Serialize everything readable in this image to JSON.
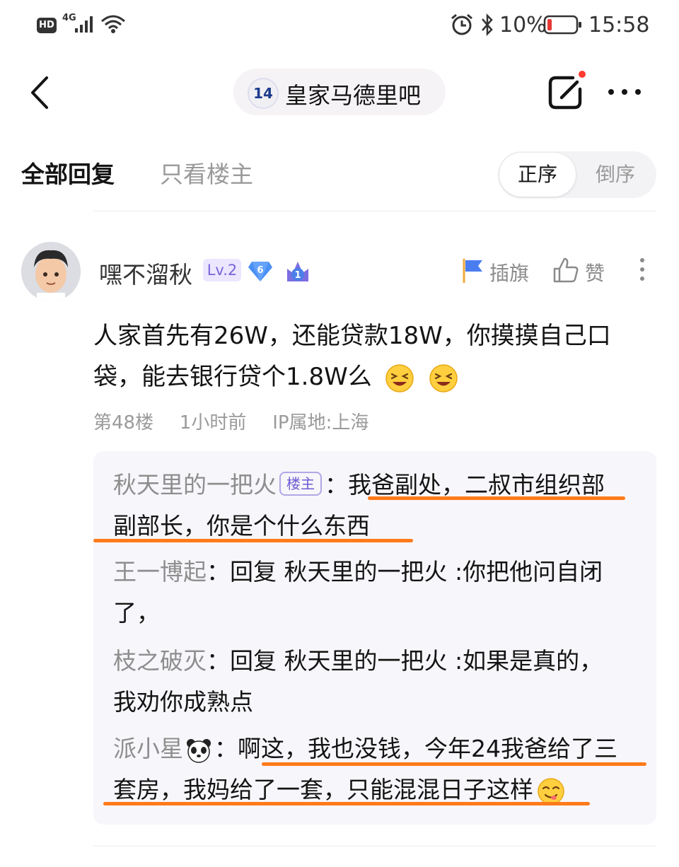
{
  "status_bar": {
    "hd": "HD",
    "network": "4G",
    "battery": "10%",
    "time": "15:58"
  },
  "nav": {
    "forum_badge": "14",
    "forum_name": "皇家马德里吧"
  },
  "tabs": {
    "all_replies": "全部回复",
    "owner_only": "只看楼主",
    "sort_asc": "正序",
    "sort_desc": "倒序"
  },
  "post": {
    "username": "嘿不溜秋",
    "level": "Lv.2",
    "badge_number": "6",
    "badge_number_2": "1",
    "flag_label": "插旗",
    "like_label": "赞",
    "content_line1": "人家首先有26W，还能贷款18W，你摸摸自己口",
    "content_line2": "袋，能去银行贷个1.8W么",
    "floor": "第48楼",
    "time_ago": "1小时前",
    "ip": "IP属地:上海"
  },
  "replies": [
    {
      "name": "秋天里的一把火",
      "tag": "楼主",
      "text_line1": "：我爸副处，二叔市组织部",
      "text_line2": "副部长，你是个什么东西"
    },
    {
      "name": "王一博起",
      "text_line1": "：回复 秋天里的一把火 :你把他问自闭",
      "text_line2": "了，"
    },
    {
      "name": "枝之破灭",
      "text_line1": "：回复 秋天里的一把火 :如果是真的，",
      "text_line2": "我劝你成熟点"
    },
    {
      "name": "派小星",
      "text_line1": "：啊这，我也没钱，今年24我爸给了三",
      "text_line2": "套房，我妈给了一套，只能混混日子这样"
    }
  ],
  "colors": {
    "accent_underline": "#ff7a1a",
    "level_badge": "#7a63d8",
    "notification_dot": "#ff3b30"
  }
}
